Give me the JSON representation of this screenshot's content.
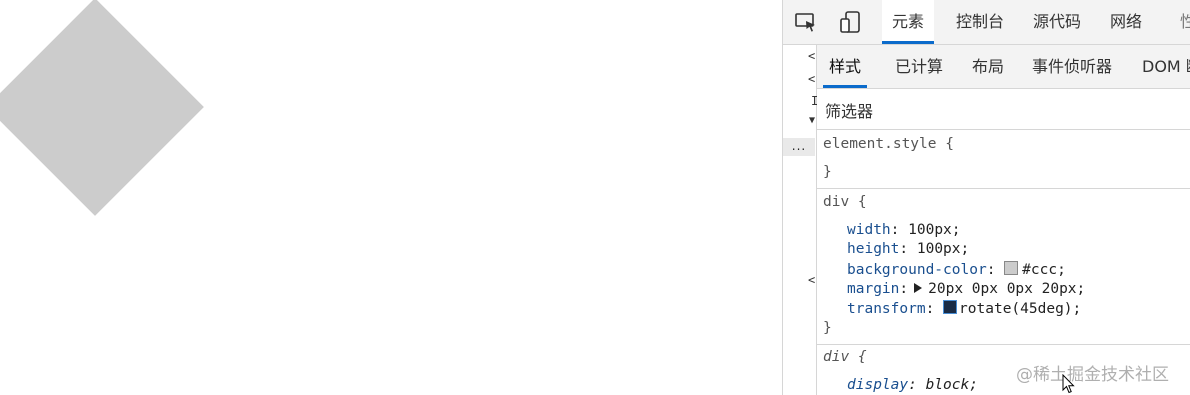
{
  "devtools": {
    "main_tabs": [
      "元素",
      "控制台",
      "源代码",
      "网络",
      "性"
    ],
    "sub_tabs": [
      "样式",
      "已计算",
      "布局",
      "事件侦听器",
      "DOM 断"
    ],
    "filter_placeholder": "筛选器",
    "dom_ellipsis": "...",
    "rules": {
      "element_style": {
        "selector": "element.style {",
        "close": "}"
      },
      "div_author": {
        "selector": "div {",
        "decls": [
          {
            "prop": "width",
            "value": "100px;"
          },
          {
            "prop": "height",
            "value": "100px;"
          },
          {
            "prop": "background-color",
            "value": "#ccc;"
          },
          {
            "prop": "margin",
            "value": "20px 0px 0px 20px;"
          },
          {
            "prop": "transform",
            "value": "rotate(45deg);"
          }
        ],
        "close": "}"
      },
      "div_useragent": {
        "selector": "div {",
        "decls": [
          {
            "prop": "display",
            "value": "block;"
          }
        ]
      }
    }
  },
  "colors": {
    "demo_fill": "#cccccc",
    "accent": "#0b6bcb"
  },
  "watermark": "@稀土掘金技术社区"
}
